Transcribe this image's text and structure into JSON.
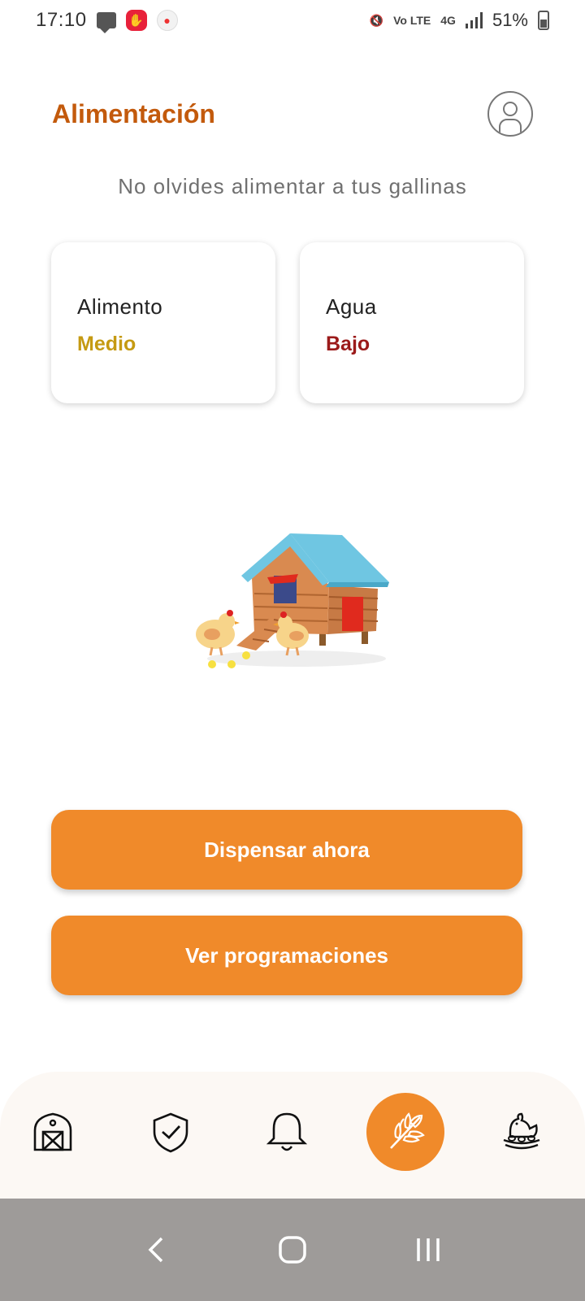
{
  "status_bar": {
    "time": "17:10",
    "volte_label": "Vo LTE",
    "network_label": "4G",
    "battery": "51%"
  },
  "header": {
    "title": "Alimentación"
  },
  "subtitle": "No olvides alimentar a tus gallinas",
  "cards": {
    "food": {
      "label": "Alimento",
      "value": "Medio",
      "value_color": "#c59a12"
    },
    "water": {
      "label": "Agua",
      "value": "Bajo",
      "value_color": "#9b1a1a"
    }
  },
  "buttons": {
    "dispense": "Dispensar ahora",
    "schedules": "Ver programaciones"
  },
  "bottom_nav": {
    "items": [
      {
        "icon": "barn-icon",
        "active": false
      },
      {
        "icon": "shield-check-icon",
        "active": false
      },
      {
        "icon": "bell-icon",
        "active": false
      },
      {
        "icon": "wheat-icon",
        "active": true
      },
      {
        "icon": "hen-nest-icon",
        "active": false
      }
    ]
  },
  "colors": {
    "accent": "#f08a2a",
    "title": "#c35a0c"
  }
}
